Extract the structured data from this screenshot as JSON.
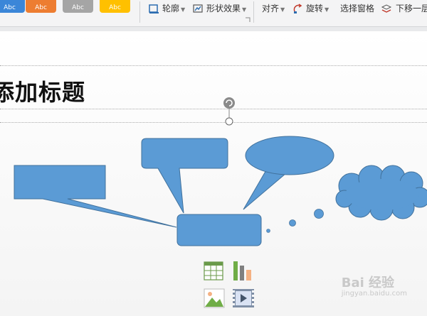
{
  "ribbon": {
    "swatches": [
      {
        "label": "Abc",
        "color": "#3b86d8"
      },
      {
        "label": "Abc",
        "color": "#ed7d31"
      },
      {
        "label": "Abc",
        "color": "#a5a5a5"
      },
      {
        "label": "Abc",
        "color": "#ffc000"
      }
    ],
    "outline_label": "轮廓",
    "shape_effects_label": "形状效果",
    "align_label": "对齐",
    "rotate_label": "旋转",
    "selection_pane_label": "选择窗格",
    "send_backward_label": "下移一层"
  },
  "slide": {
    "title_text": "添加标题"
  },
  "shapes": {
    "fill_color": "#5b9bd5",
    "stroke_color": "#41719c"
  },
  "placeholder_icons": [
    "table-icon",
    "chart-icon",
    "picture-icon",
    "video-icon"
  ],
  "watermark": {
    "brand": "Bai 经验",
    "url": "jingyan.baidu.com"
  }
}
